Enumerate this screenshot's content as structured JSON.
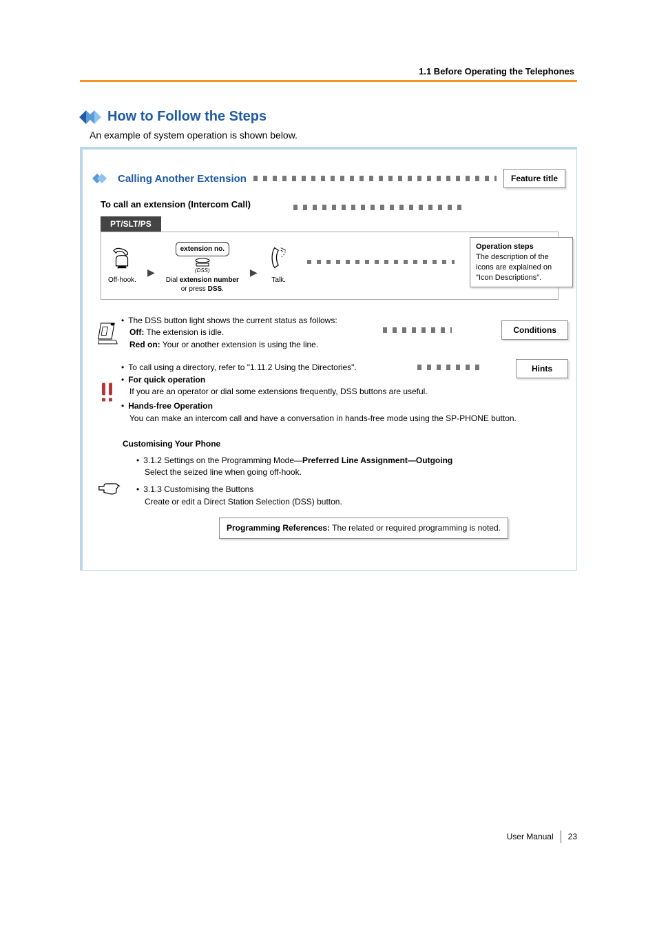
{
  "header": {
    "breadcrumb": "1.1 Before Operating the Telephones"
  },
  "section": {
    "title": "How to Follow the Steps",
    "intro": "An example of system operation is shown below."
  },
  "example": {
    "feature_title_label": "Feature title",
    "feature_title": "Calling Another Extension",
    "sub_title": "To call an extension (Intercom Call)",
    "tab": "PT/SLT/PS",
    "steps": {
      "offhook": "Off-hook.",
      "ext_box": "extension no.",
      "dss_label": "(DSS)",
      "dial_line1": "Dial extension number",
      "dial_line2": "or press DSS.",
      "talk": "Talk."
    },
    "operation_steps": {
      "title": "Operation steps",
      "body": "The description of the icons are explained on \"Icon Descriptions\"."
    },
    "conditions": {
      "label": "Conditions",
      "line1": "The DSS button light shows the current status as follows:",
      "off_label": "Off:",
      "off_text": " The extension is idle.",
      "red_label": "Red on:",
      "red_text": " Your or another extension is using the line."
    },
    "hints": {
      "label": "Hints",
      "directory": "To call using a directory, refer to \"1.11.2 Using the Directories\".",
      "quick_title": "For quick operation",
      "quick_body": "If you are an operator or dial some extensions frequently, DSS buttons are useful.",
      "hands_title": "Hands-free Operation",
      "hands_body": "You can make an intercom call and have a conversation in hands-free mode using the SP-PHONE button."
    },
    "customising": {
      "title": "Customising Your Phone",
      "item1_prefix": "3.1.2 Settings on the Programming Mode—",
      "item1_bold": "Preferred Line Assignment—Outgoing",
      "item1_body": "Select the seized line when going off-hook.",
      "item2_title": "3.1.3 Customising the Buttons",
      "item2_body": "Create or edit a Direct Station Selection (DSS) button."
    },
    "programming_ref": {
      "label": "Programming References:",
      "text": " The related or required programming is noted."
    }
  },
  "footer": {
    "label": "User Manual",
    "page": "23"
  }
}
